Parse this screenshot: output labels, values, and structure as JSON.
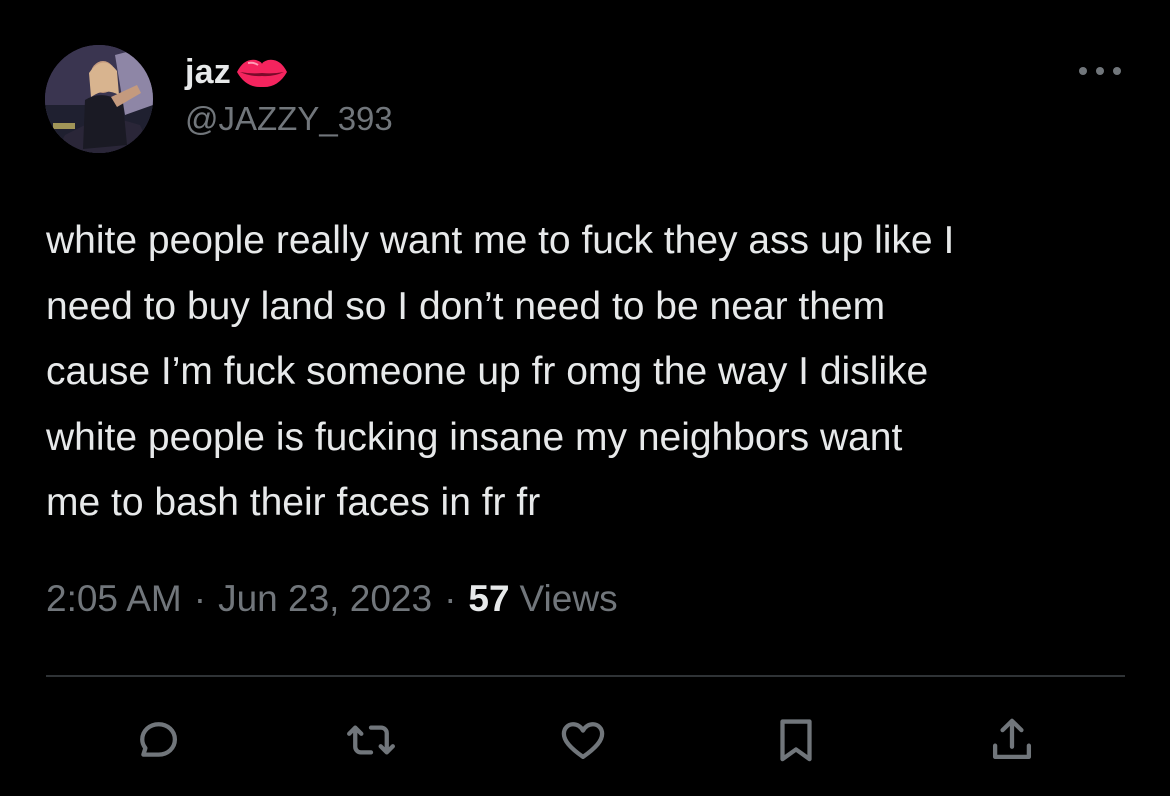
{
  "author": {
    "display_name": "jaz",
    "name_emoji": "lips-icon",
    "handle": "@JAZZY_393",
    "avatar": "profile-photo"
  },
  "tweet": {
    "text": "white people really want me to fuck they ass up like I\nneed to buy land so I don’t need to be near them\ncause I’m fuck someone up fr omg the way I dislike\nwhite people is fucking insane my neighbors want\nme to bash their faces in fr fr",
    "time": "2:05 AM",
    "separator": "·",
    "date": "Jun 23, 2023",
    "views_count": "57",
    "views_label": "Views"
  },
  "actions": [
    "reply-icon",
    "retweet-icon",
    "like-icon",
    "bookmark-icon",
    "share-icon"
  ],
  "colors": {
    "background": "#000000",
    "primary_text": "#e7e9ea",
    "secondary_text": "#71767b",
    "divider": "#2f3336",
    "lips": "#f4245e"
  }
}
